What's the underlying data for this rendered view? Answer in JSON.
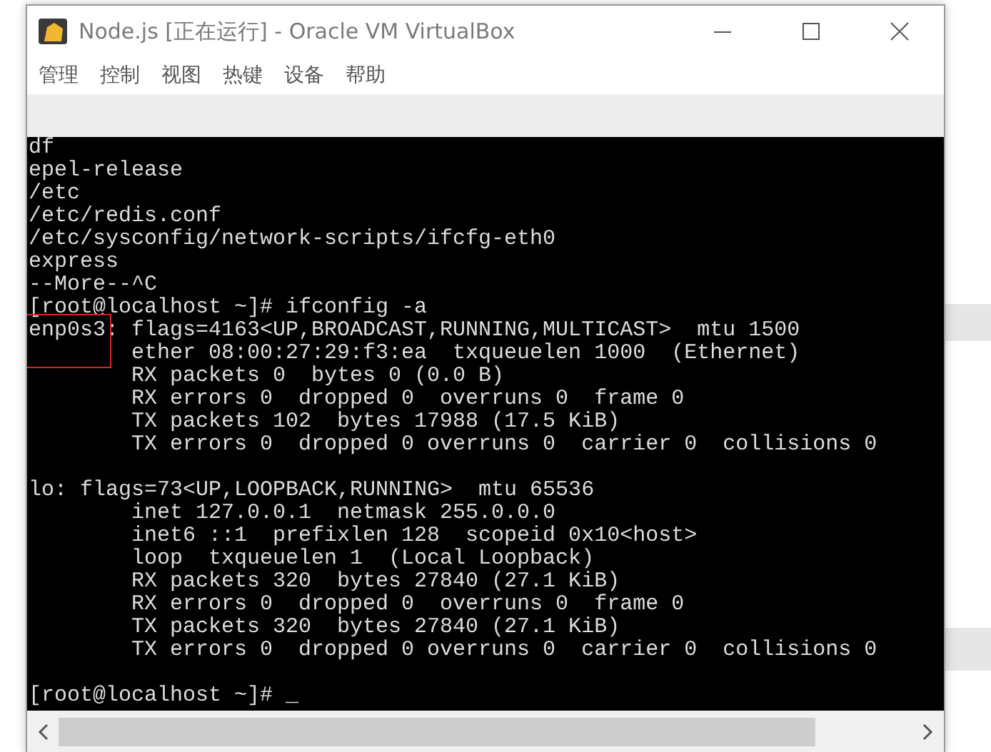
{
  "window": {
    "title": "Node.js [正在运行] - Oracle VM VirtualBox"
  },
  "menu": [
    "管理",
    "控制",
    "视图",
    "热键",
    "设备",
    "帮助"
  ],
  "terminal": {
    "lines": [
      {
        "text": "df"
      },
      {
        "text": "epel-release"
      },
      {
        "text": "/etc"
      },
      {
        "text": "/etc/redis.conf"
      },
      {
        "text": "/etc/sysconfig/network-scripts/ifcfg-eth0"
      },
      {
        "text": "express"
      },
      {
        "text": "--More--^C"
      },
      {
        "text": "[root@localhost ~]# ifconfig -a"
      },
      {
        "text": "enp0s3: flags=4163<UP,BROADCAST,RUNNING,MULTICAST>  mtu 1500",
        "highlighted": true
      },
      {
        "text": "        ether 08:00:27:29:f3:ea  txqueuelen 1000  (Ethernet)"
      },
      {
        "text": "        RX packets 0  bytes 0 (0.0 B)"
      },
      {
        "text": "        RX errors 0  dropped 0  overruns 0  frame 0"
      },
      {
        "text": "        TX packets 102  bytes 17988 (17.5 KiB)"
      },
      {
        "text": "        TX errors 0  dropped 0 overruns 0  carrier 0  collisions 0"
      },
      {
        "text": "lo: flags=73<UP,LOOPBACK,RUNNING>  mtu 65536",
        "gap_before": true
      },
      {
        "text": "        inet 127.0.0.1  netmask 255.0.0.0"
      },
      {
        "text": "        inet6 ::1  prefixlen 128  scopeid 0x10<host>"
      },
      {
        "text": "        loop  txqueuelen 1  (Local Loopback)"
      },
      {
        "text": "        RX packets 320  bytes 27840 (27.1 KiB)"
      },
      {
        "text": "        RX errors 0  dropped 0  overruns 0  frame 0"
      },
      {
        "text": "        TX packets 320  bytes 27840 (27.1 KiB)"
      },
      {
        "text": "        TX errors 0  dropped 0 overruns 0  carrier 0  collisions 0"
      },
      {
        "text": "[root@localhost ~]# _",
        "gap_before": true
      }
    ]
  }
}
